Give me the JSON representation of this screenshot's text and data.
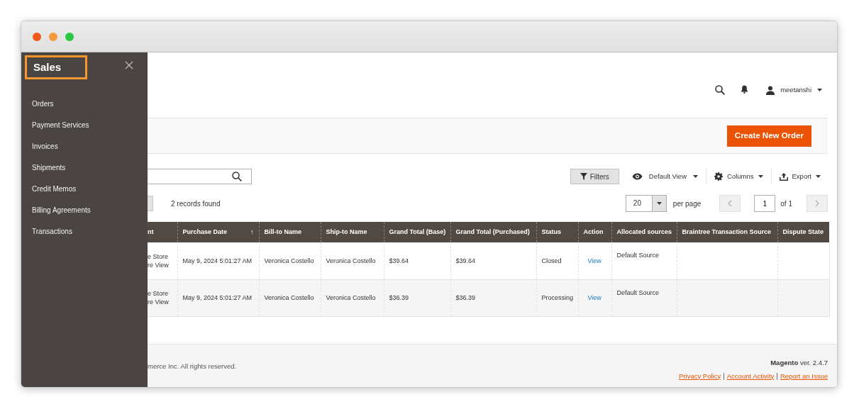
{
  "window": {
    "controls": [
      {
        "color": "#ee5a1a"
      },
      {
        "color": "#f39a3c"
      },
      {
        "color": "#2ac840"
      }
    ]
  },
  "sidebar": {
    "title": "Sales",
    "items": [
      {
        "label": "Orders"
      },
      {
        "label": "Payment Services"
      },
      {
        "label": "Invoices"
      },
      {
        "label": "Shipments"
      },
      {
        "label": "Credit Memos"
      },
      {
        "label": "Billing Agreements"
      },
      {
        "label": "Transactions"
      }
    ]
  },
  "header": {
    "user": "meetanshi"
  },
  "action_bar": {
    "primary_button": "Create New Order"
  },
  "toolbar": {
    "filters": "Filters",
    "view": "Default View",
    "columns": "Columns",
    "export": "Export"
  },
  "grid": {
    "records": "2 records found",
    "page_size": "20",
    "per_page": "per page",
    "page": "1",
    "page_total": "of 1",
    "columns": [
      {
        "label": "nt",
        "kind": "text"
      },
      {
        "label": "Purchase Date",
        "kind": "text",
        "sort_arrow": "↑"
      },
      {
        "label": "Bill-to Name",
        "kind": "text"
      },
      {
        "label": "Ship-to Name",
        "kind": "text"
      },
      {
        "label": "Grand Total (Base)",
        "kind": "text"
      },
      {
        "label": "Grand Total (Purchased)",
        "kind": "text"
      },
      {
        "label": "Status",
        "kind": "text"
      },
      {
        "label": "Action",
        "kind": "link"
      },
      {
        "label": "Allocated sources",
        "kind": "top"
      },
      {
        "label": "Braintree Transaction Source",
        "kind": "text"
      },
      {
        "label": "Dispute State",
        "kind": "text"
      }
    ],
    "rows": [
      [
        "e Store\nre View",
        "May 9, 2024 5:01:27 AM",
        "Veronica Costello",
        "Veronica Costello",
        "$39.64",
        "$39.64",
        "Closed",
        "View",
        "Default Source",
        "",
        ""
      ],
      [
        "e Store\nre View",
        "May 9, 2024 5:01:27 AM",
        "Veronica Costello",
        "Veronica Costello",
        "$36.39",
        "$36.39",
        "Processing",
        "View",
        "Default Source",
        "",
        ""
      ]
    ]
  },
  "footer": {
    "copyright": "merce Inc. All rights reserved.",
    "version_label": "Magento",
    "version": "ver. 2.4.7",
    "links": [
      "Privacy Policy",
      "Account Activity",
      "Report an Issue"
    ],
    "separators": [
      "|",
      "|"
    ]
  }
}
